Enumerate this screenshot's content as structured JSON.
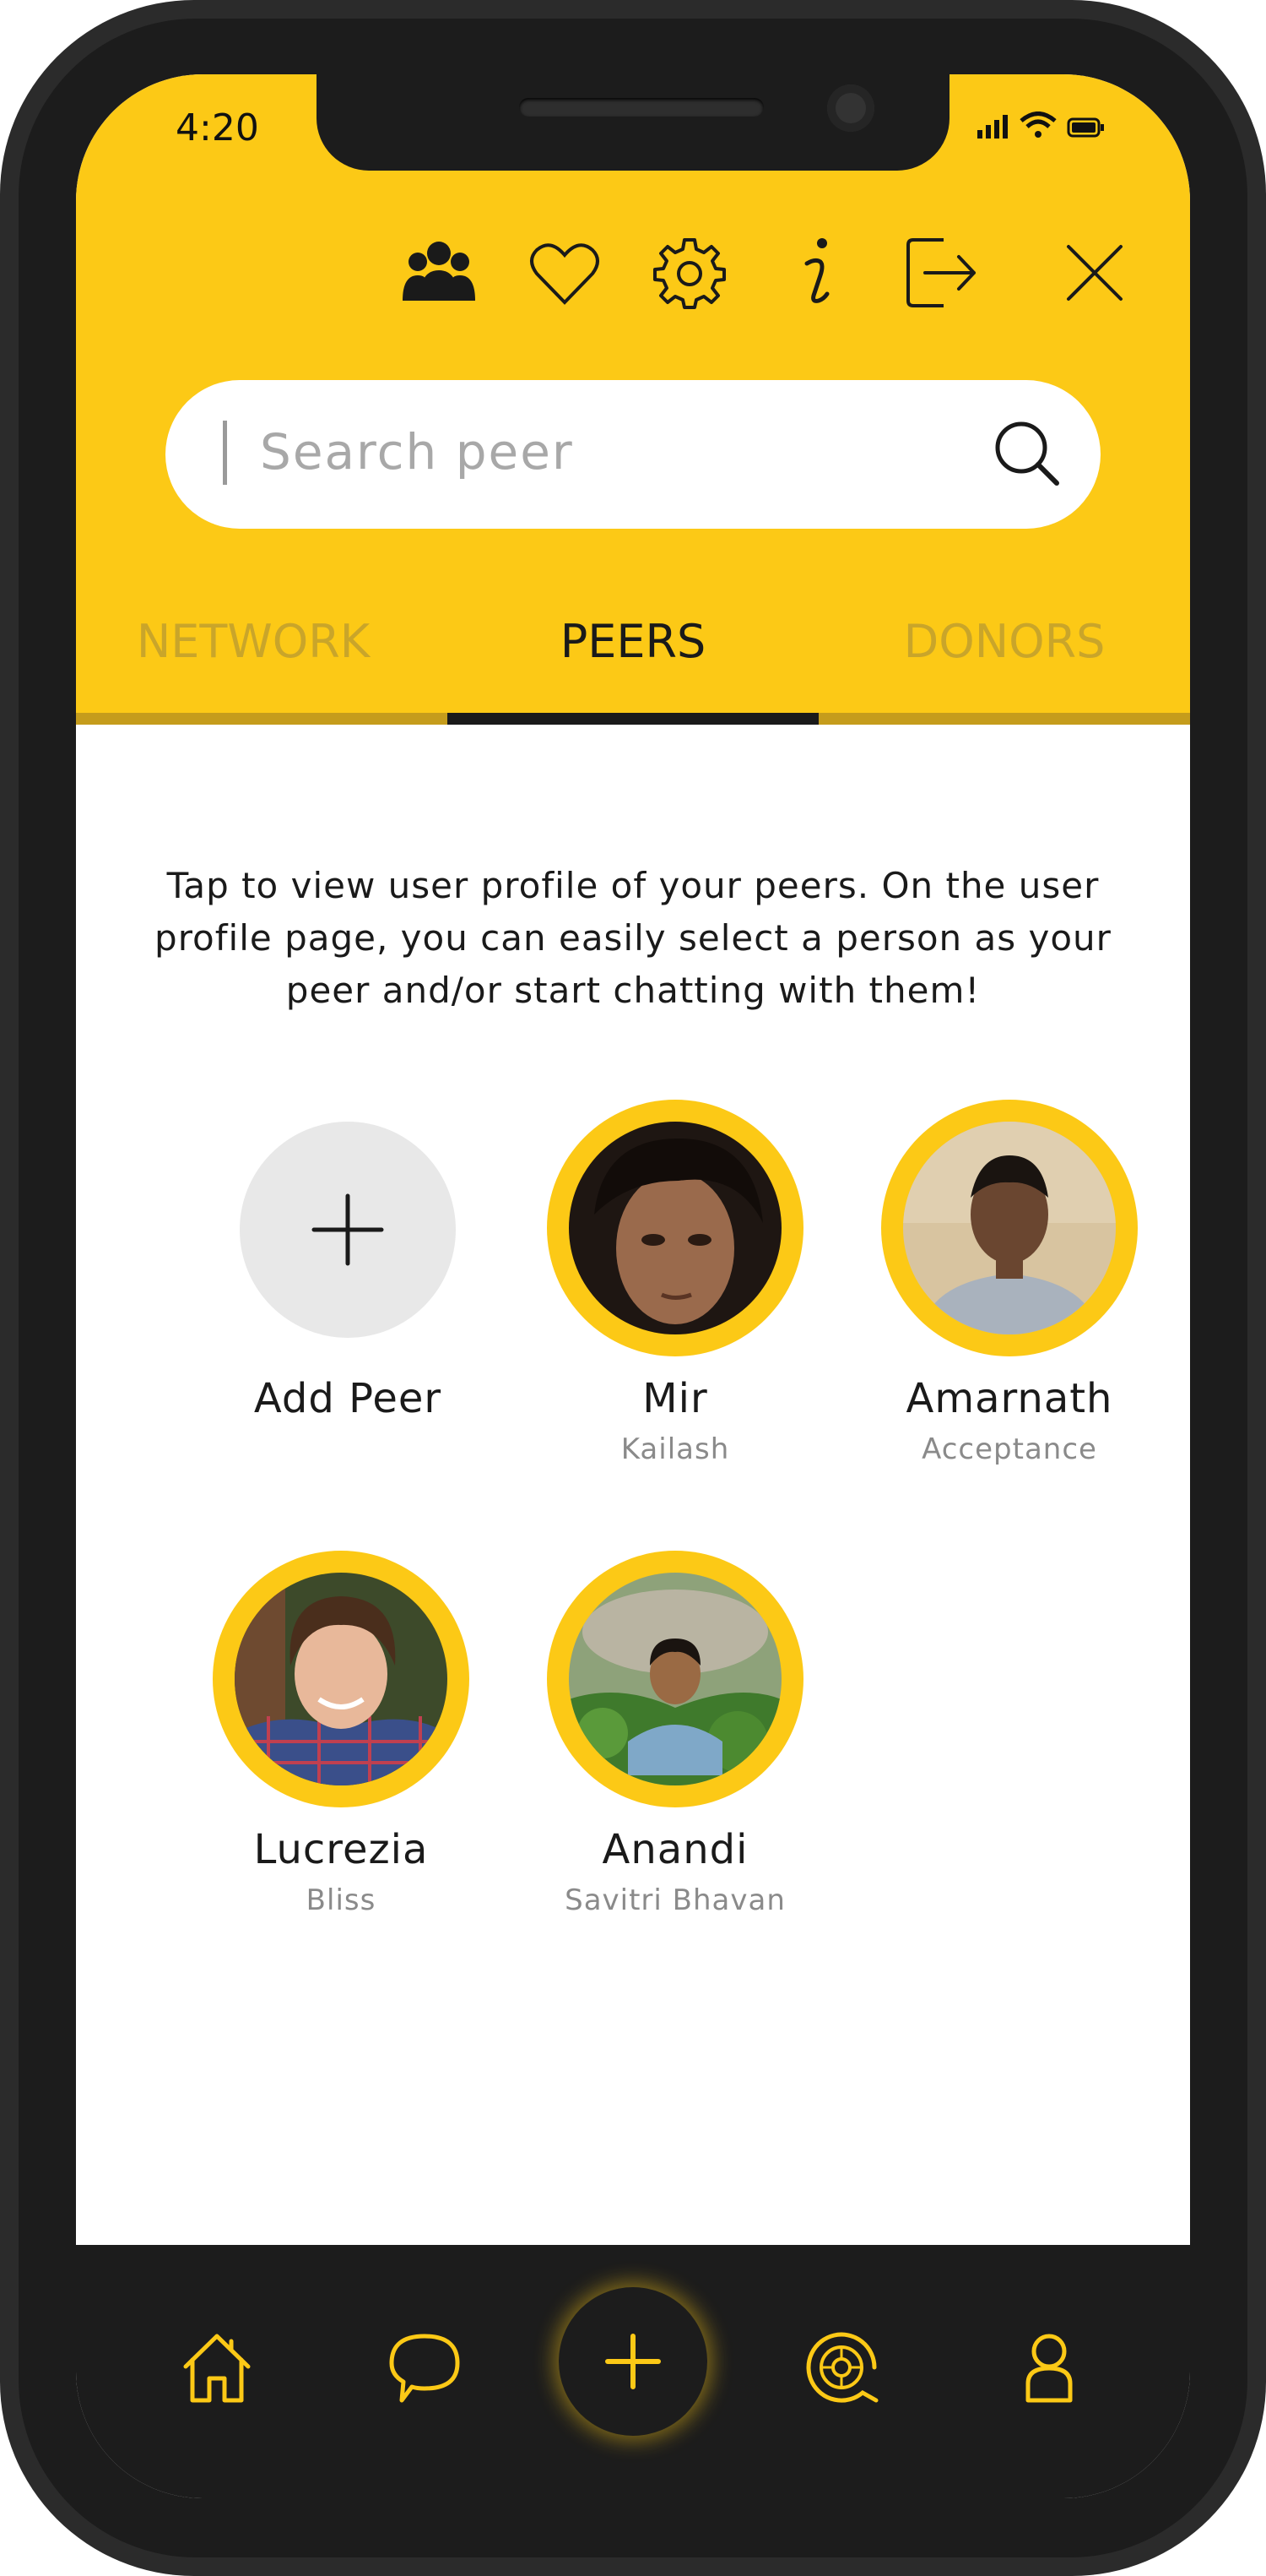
{
  "status_bar": {
    "time": "4:20"
  },
  "toolbar": {
    "icons": [
      "group-icon",
      "heart-icon",
      "gear-icon",
      "info-icon",
      "logout-icon",
      "close-icon"
    ]
  },
  "search": {
    "placeholder": "Search peer"
  },
  "tabs": [
    {
      "label": "NETWORK",
      "active": false
    },
    {
      "label": "PEERS",
      "active": true
    },
    {
      "label": "DONORS",
      "active": false
    }
  ],
  "intro_text": "Tap to view user profile of your peers. On the user profile page, you can easily select a person as your peer and/or start chatting with them!",
  "add_peer": {
    "label": "Add Peer"
  },
  "peers": [
    {
      "name": "Mir",
      "subtitle": "Kailash"
    },
    {
      "name": "Amarnath",
      "subtitle": "Acceptance"
    },
    {
      "name": "Lucrezia",
      "subtitle": "Bliss"
    },
    {
      "name": "Anandi",
      "subtitle": "Savitri Bhavan"
    }
  ],
  "bottom_nav": {
    "items": [
      "home-icon",
      "chat-icon",
      "add-icon",
      "meditation-icon",
      "profile-icon"
    ]
  },
  "colors": {
    "accent": "#fcc916",
    "dark": "#1c1c1c",
    "muted_tab": "#c9a52a"
  }
}
